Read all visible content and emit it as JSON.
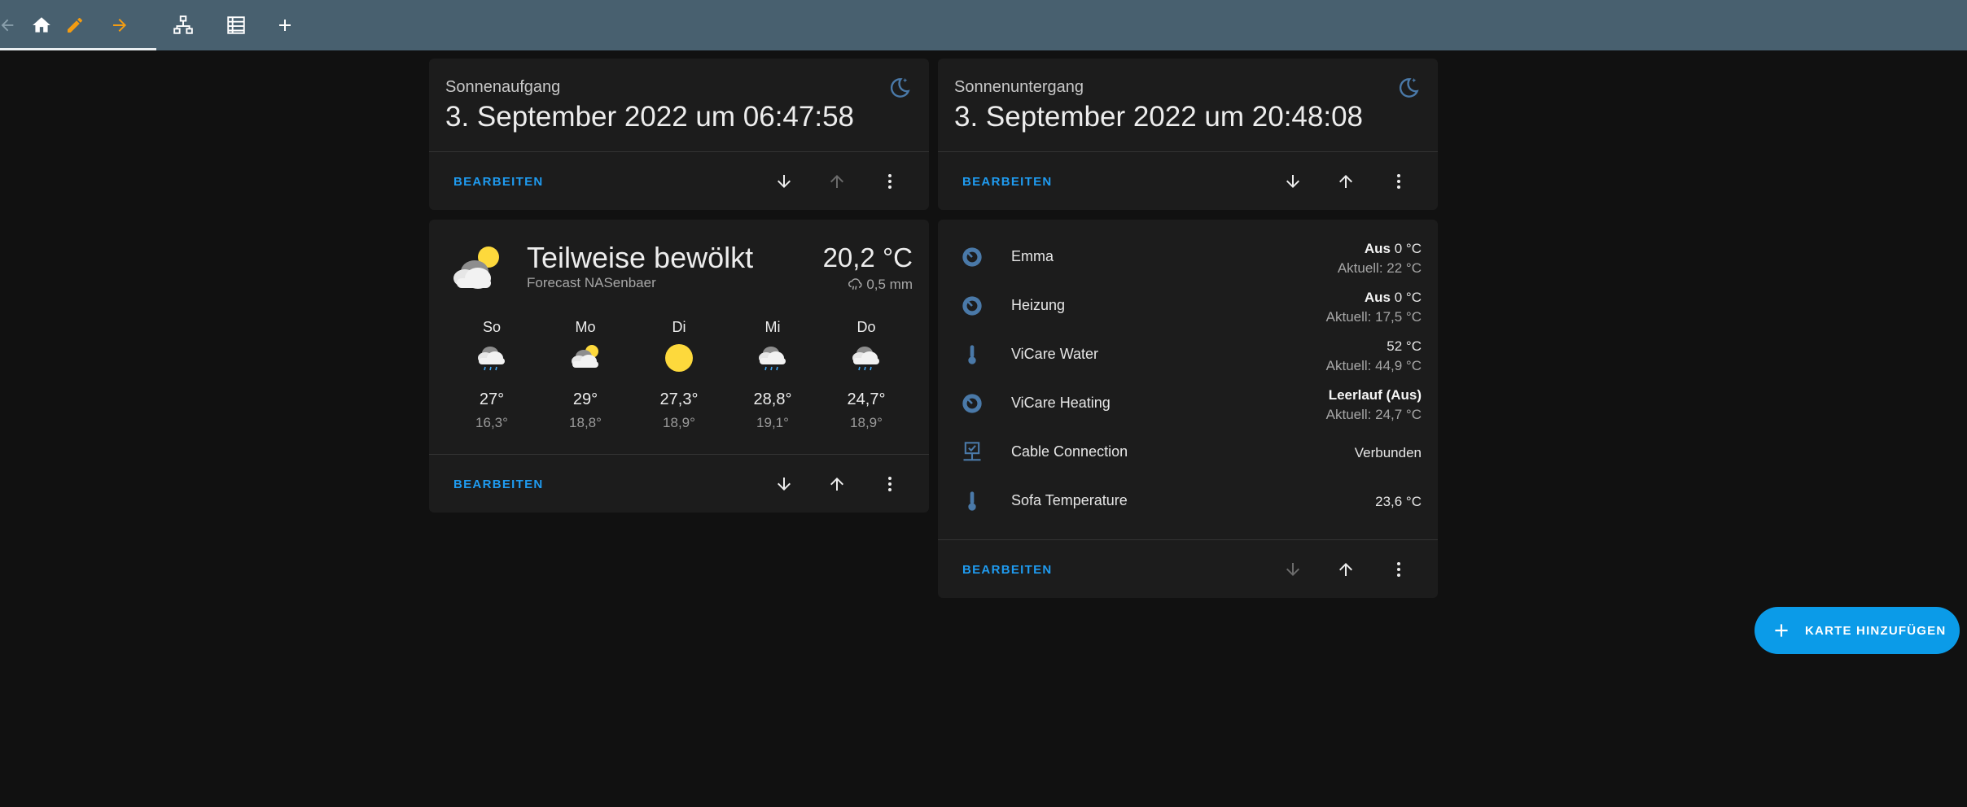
{
  "toolbar": {
    "icons": [
      "arrow-left-icon",
      "home-icon",
      "pencil-icon",
      "arrow-right-icon",
      "sitemap-icon",
      "table-rows-icon",
      "plus-icon"
    ]
  },
  "colors": {
    "toolbar_bg": "#48606f",
    "card_bg": "#1c1c1c",
    "page_bg": "#111111",
    "accent": "#1f9bf0",
    "fab_bg": "#0b9be8",
    "icon_blue": "#4a79a8",
    "sun_yellow": "#fdd93c",
    "edit_orange": "#f39c12"
  },
  "sunrise_card": {
    "label": "Sonnenaufgang",
    "value": "3. September 2022 um 06:47:58",
    "edit_label": "BEARBEITEN"
  },
  "sunset_card": {
    "label": "Sonnenuntergang",
    "value": "3. September 2022 um 20:48:08",
    "edit_label": "BEARBEITEN"
  },
  "weather_card": {
    "condition": "Teilweise bewölkt",
    "name": "Forecast NASenbaer",
    "temperature": "20,2 °C",
    "precipitation": "0,5 mm",
    "edit_label": "BEARBEITEN",
    "forecast": [
      {
        "day": "So",
        "icon": "rainy-icon",
        "high": "27°",
        "low": "16,3°"
      },
      {
        "day": "Mo",
        "icon": "partly-cloudy-icon",
        "high": "29°",
        "low": "18,8°"
      },
      {
        "day": "Di",
        "icon": "sunny-icon",
        "high": "27,3°",
        "low": "18,9°"
      },
      {
        "day": "Mi",
        "icon": "rainy-icon",
        "high": "28,8°",
        "low": "19,1°"
      },
      {
        "day": "Do",
        "icon": "rainy-icon",
        "high": "24,7°",
        "low": "18,9°"
      }
    ]
  },
  "entities_card": {
    "edit_label": "BEARBEITEN",
    "rows": [
      {
        "name": "Emma",
        "icon": "thermostat-icon",
        "state_bold": "Aus",
        "state": " 0 °C",
        "sub": "Aktuell: 22 °C"
      },
      {
        "name": "Heizung",
        "icon": "thermostat-icon",
        "state_bold": "Aus",
        "state": " 0 °C",
        "sub": "Aktuell: 17,5 °C"
      },
      {
        "name": "ViCare Water",
        "icon": "thermometer-icon",
        "state_bold": "",
        "state": "52 °C",
        "sub": "Aktuell: 44,9 °C"
      },
      {
        "name": "ViCare Heating",
        "icon": "thermostat-icon",
        "state_bold": "Leerlauf (Aus)",
        "state": "",
        "sub": "Aktuell: 24,7 °C"
      },
      {
        "name": "Cable Connection",
        "icon": "lan-check-icon",
        "state_bold": "",
        "state": "Verbunden",
        "sub": ""
      },
      {
        "name": "Sofa Temperature",
        "icon": "thermometer-icon",
        "state_bold": "",
        "state": "23,6 °C",
        "sub": ""
      }
    ]
  },
  "fab": {
    "label": "KARTE HINZUFÜGEN",
    "icon": "plus-icon"
  }
}
